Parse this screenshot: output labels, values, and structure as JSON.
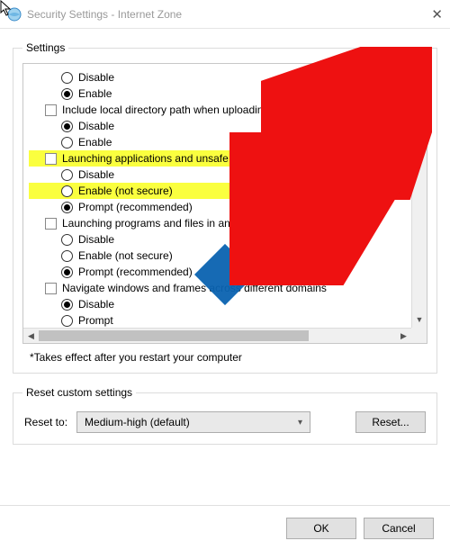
{
  "window": {
    "title": "Security Settings - Internet Zone"
  },
  "settings": {
    "legend": "Settings",
    "footnote": "*Takes effect after you restart your computer",
    "items": [
      {
        "type": "radio",
        "label": "Disable",
        "indent": 2,
        "selected": false,
        "hl": false
      },
      {
        "type": "radio",
        "label": "Enable",
        "indent": 2,
        "selected": true,
        "hl": false
      },
      {
        "type": "check",
        "label": "Include local directory path when uploading files to a server",
        "indent": 1,
        "hl": false
      },
      {
        "type": "radio",
        "label": "Disable",
        "indent": 2,
        "selected": true,
        "hl": false
      },
      {
        "type": "radio",
        "label": "Enable",
        "indent": 2,
        "selected": false,
        "hl": false
      },
      {
        "type": "check",
        "label": "Launching applications and unsafe files",
        "indent": 1,
        "hl": true
      },
      {
        "type": "radio",
        "label": "Disable",
        "indent": 2,
        "selected": false,
        "hl": false
      },
      {
        "type": "radio",
        "label": "Enable (not secure)",
        "indent": 2,
        "selected": false,
        "hl": true
      },
      {
        "type": "radio",
        "label": "Prompt (recommended)",
        "indent": 2,
        "selected": true,
        "hl": false
      },
      {
        "type": "check",
        "label": "Launching programs and files in an IFRAME",
        "indent": 1,
        "hl": false
      },
      {
        "type": "radio",
        "label": "Disable",
        "indent": 2,
        "selected": false,
        "hl": false
      },
      {
        "type": "radio",
        "label": "Enable (not secure)",
        "indent": 2,
        "selected": false,
        "hl": false
      },
      {
        "type": "radio",
        "label": "Prompt (recommended)",
        "indent": 2,
        "selected": true,
        "hl": false
      },
      {
        "type": "check",
        "label": "Navigate windows and frames across different domains",
        "indent": 1,
        "hl": false
      },
      {
        "type": "radio",
        "label": "Disable",
        "indent": 2,
        "selected": true,
        "hl": false
      },
      {
        "type": "radio",
        "label": "Prompt",
        "indent": 2,
        "selected": false,
        "hl": false
      }
    ]
  },
  "reset": {
    "legend": "Reset custom settings",
    "label": "Reset to:",
    "value": "Medium-high (default)",
    "button": "Reset..."
  },
  "footer": {
    "ok": "OK",
    "cancel": "Cancel"
  }
}
